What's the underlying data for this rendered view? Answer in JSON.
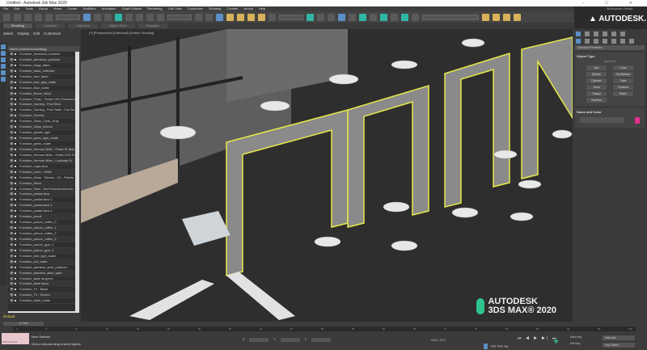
{
  "window": {
    "title": "Untitled - Autodesk 3ds Max 2020",
    "controls": "– ☐ ✕"
  },
  "menu": [
    "File",
    "Edit",
    "Tools",
    "Group",
    "Views",
    "Create",
    "Modifiers",
    "Animation",
    "Graph Editors",
    "Rendering",
    "Civil View",
    "Customize",
    "Scripting",
    "Content",
    "Arnold",
    "Help"
  ],
  "ribbon": {
    "tabs": [
      "Modeling",
      "Freeform",
      "Selection",
      "Object Paint",
      "Populate"
    ]
  },
  "brand": {
    "logo": "AUTODESK.",
    "workspaces_label": "Workspaces:",
    "workspace": "Default"
  },
  "scene_explorer": {
    "menu": [
      "Select",
      "Display",
      "Edit",
      "Customize"
    ],
    "header": "Name (Sorted Ascending)",
    "items": [
      "Furniture_Aluminum_brushed",
      "Furniture_aluminum_polished",
      "Furniture_beige_fabric",
      "Furniture_black_reflective",
      "Furniture_blue_fabric",
      "Furniture_blue_light_matte",
      "Furniture_Blue_matte",
      "Furniture_Brown_fabric",
      "Furniture_Finish - Finish VHG Polished Al",
      "Furniture_Gaming - Pool Stick",
      "Furniture_Gaming - Pool Table - Cue Ba",
      "Furniture_Generic",
      "Furniture_Glass_Clear_Gray",
      "Furniture_Glass_etched",
      "Furniture_granite_light",
      "Furniture_green_light_matte",
      "Furniture_green_matte",
      "Furniture_Herman Miller - Finish 91 Blac",
      "Furniture_Herman Miller - Finish VHG Po",
      "Furniture_Herman Miller - Laminate 91",
      "Furniture_hojas lisos",
      "Furniture_Linen - White",
      "Furniture_Metal - Teknion - C5 - Polishe",
      "Furniture_Mirror",
      "Furniture_Paint - Red Polished Aluminu",
      "Furniture_pastas lisos",
      "Furniture_pastas lisos 2",
      "Furniture_pastas lisos 3",
      "Furniture_pastas lisos 4",
      "Furniture_pencil",
      "Furniture_picture_coffee_0",
      "Furniture_picture_coffee_1",
      "Furniture_picture_coffee_2",
      "Furniture_picture_coffee_3",
      "Furniture_picture_gym_1",
      "Furniture_picture_gym_2",
      "Furniture_pink_light_matte",
      "Furniture_red_matte",
      "Furniture_stainless_steel_polished",
      "Furniture_stainless_steel_satin",
      "Furniture_table fat green",
      "Furniture_table frame",
      "Furniture_TV - Black",
      "Furniture_TV - Screen",
      "Furniture_white_matte"
    ],
    "layer": "Default"
  },
  "viewport": {
    "label": "[+] [Perspective] [Standard] [Default Shading]",
    "logo_line1": "AUTODESK",
    "logo_line2": "3DS MAX® 2020",
    "outline_color": "#e6e84a"
  },
  "command_panel": {
    "category": "Standard Primitives",
    "rollout_object_type": "Object Type",
    "autogrid": "AutoGrid",
    "buttons": [
      "Box",
      "Cone",
      "Sphere",
      "GeoSphere",
      "Cylinder",
      "Tube",
      "Torus",
      "Pyramid",
      "Teapot",
      "Plane",
      "TextPlus"
    ],
    "rollout_name_color": "Name and Color",
    "object_color": "#e02f8c"
  },
  "timeline": {
    "frame": "0 / 100",
    "ticks": [
      "0",
      "5",
      "10",
      "15",
      "20",
      "25",
      "30",
      "35",
      "40",
      "45",
      "50",
      "55",
      "60",
      "65",
      "70",
      "75",
      "80",
      "85",
      "90",
      "95",
      "100"
    ]
  },
  "status": {
    "maxscript": "MAXScript Mi",
    "selection": "None Selected",
    "prompt": "Click or click-and-drag to select objects",
    "grid": "Grid = 10.0",
    "time_tag": "Add Time Tag",
    "auto_key": "Auto Key",
    "set_key": "Set Key",
    "selected": "Selected",
    "key_filters": "Key Filters...",
    "playback": "⏮ ◀ ▶ ▶| ⏭"
  }
}
